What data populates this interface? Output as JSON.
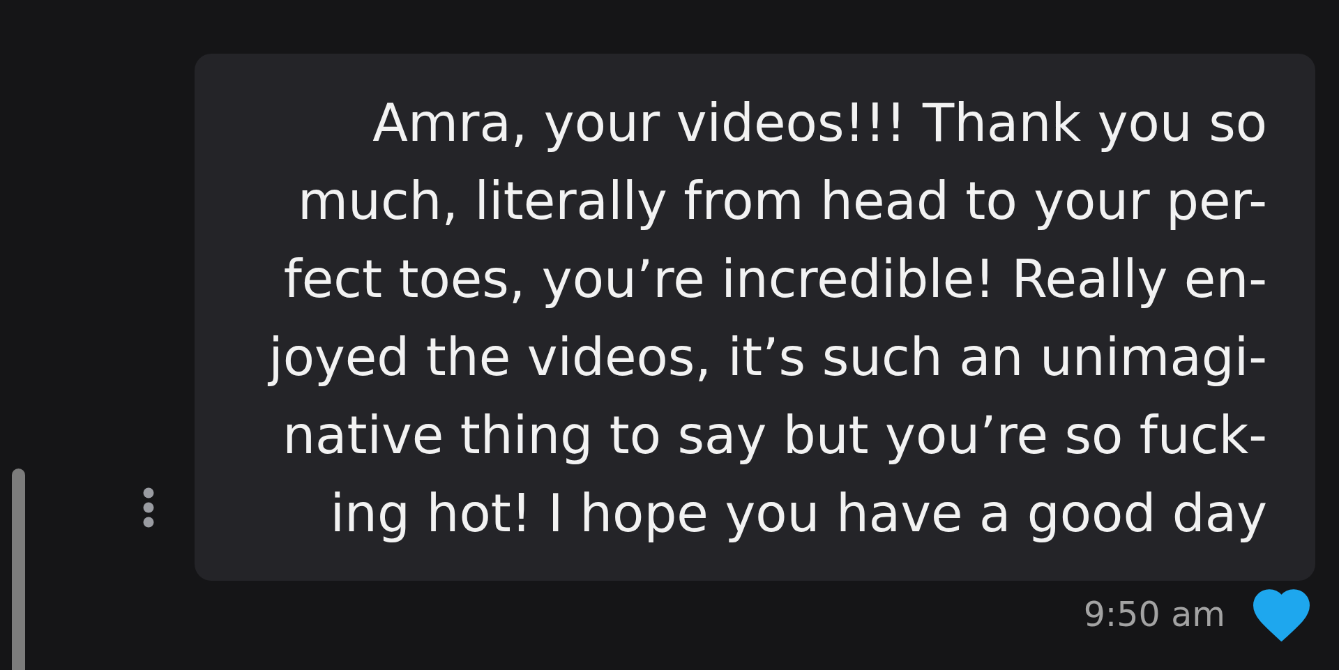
{
  "message": {
    "lines": [
      "Amra, your videos!!! Thank you so",
      "much, literally from head to your per-",
      "fect toes, you’re incredible! Really en-",
      "joyed the videos, it’s such an unimagi-",
      "native thing to say but you’re so fuck-",
      "ing hot! I hope you have a good day"
    ],
    "liked": true,
    "time": "9:50 am"
  }
}
